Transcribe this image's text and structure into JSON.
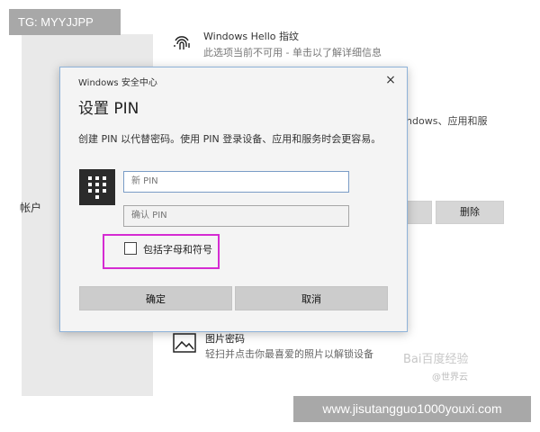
{
  "overlay": {
    "top_tag": "TG: MYYJJPP",
    "bottom_tag": "www.jisutangguo1000youxi.com",
    "watermark": "Bai百度经验",
    "watermark_sub": "@世界云"
  },
  "background": {
    "left_label": "帐户",
    "hello_item": {
      "icon": "fingerprint-icon",
      "title": "Windows Hello 指纹",
      "desc": "此选项当前不可用 - 单击以了解详细信息"
    },
    "right_text": "indows、应用和服",
    "buttons": [
      "",
      "删除"
    ],
    "picture_item": {
      "icon": "picture-icon",
      "title": "图片密码",
      "desc": "轻扫并点击你最喜爱的照片以解锁设备"
    }
  },
  "dialog": {
    "app_name": "Windows 安全中心",
    "close": "×",
    "title": "设置 PIN",
    "description": "创建 PIN 以代替密码。使用 PIN 登录设备、应用和服务时会更容易。",
    "pin_icon": "keypad-icon",
    "new_pin_placeholder": "新 PIN",
    "confirm_pin_placeholder": "确认 PIN",
    "checkbox_label": "包括字母和符号",
    "checkbox_checked": false,
    "ok_label": "确定",
    "cancel_label": "取消",
    "highlight_color": "#d52bd2",
    "accent_border": "#8fb3d9"
  }
}
